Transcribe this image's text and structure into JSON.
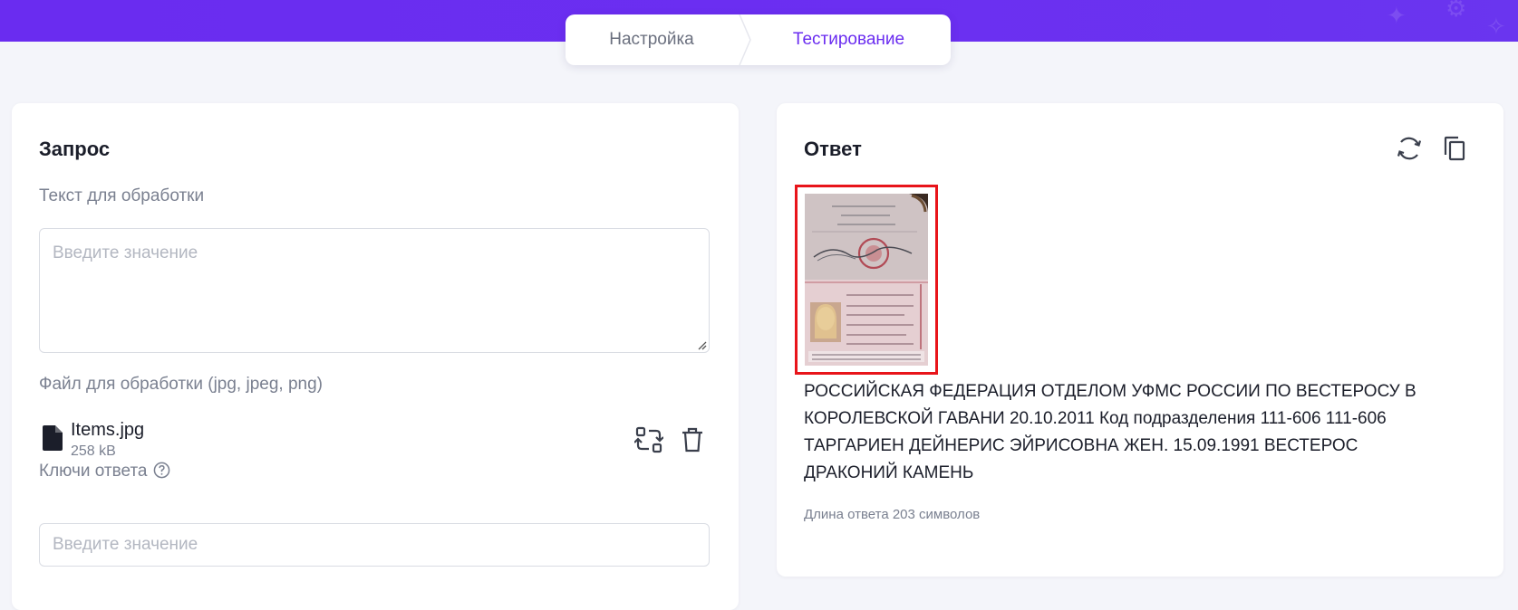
{
  "stepper": {
    "steps": [
      {
        "label": "Настройка",
        "active": false
      },
      {
        "label": "Тестирование",
        "active": true
      }
    ],
    "accent": "#6a2cf0"
  },
  "request": {
    "title": "Запрос",
    "text_label": "Текст для обработки",
    "text_placeholder": "Введите значение",
    "file_label": "Файл для обработки (jpg, jpeg, png)",
    "file": {
      "name": "Items.jpg",
      "size": "258 kB",
      "icon": "file-icon"
    },
    "keys_label": "Ключи ответа",
    "keys_placeholder": "Введите значение"
  },
  "response": {
    "title": "Ответ",
    "image": {
      "icon": "passport-image",
      "highlight_color": "#e8141a"
    },
    "text": "РОССИЙСКАЯ ФЕДЕРАЦИЯ ОТДЕЛОМ УФМС РОССИИ ПО ВЕСТЕРОСУ В КОРОЛЕВСКОЙ ГАВАНИ 20.10.2011 Код подразделения 111-606 111-606 ТАРГАРИЕН ДЕЙНЕРИС ЭЙРИСОВНА ЖЕН. 15.09.1991 ВЕСТЕРОС ДРАКОНИЙ КАМЕНЬ",
    "length_label": "Длина ответа 203 символов"
  }
}
